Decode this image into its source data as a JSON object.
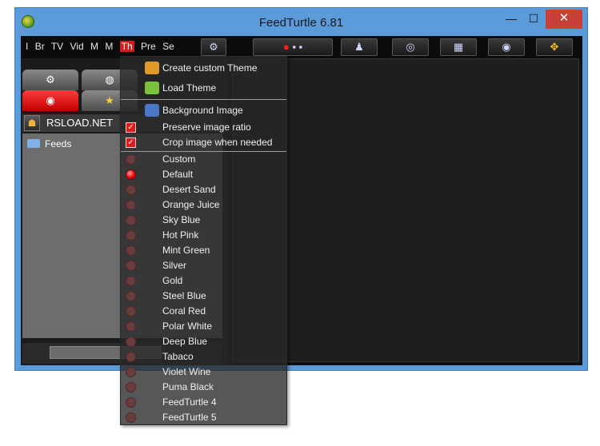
{
  "window": {
    "title": "FeedTurtle 6.81",
    "min_glyph": "—",
    "max_glyph": "☐",
    "close_glyph": "✕"
  },
  "menubar": [
    "I",
    "Br",
    "TV",
    "Vid",
    "M",
    "M",
    "Th",
    "Pre",
    "Se"
  ],
  "toolbar_icons": [
    "settings-icon",
    "record-icon",
    "speaker-icon",
    "clapper-icon",
    "globe-icon",
    "fullscreen-icon"
  ],
  "left": {
    "feed_source": "RSLOAD.NET",
    "tree_items": [
      "Feeds"
    ]
  },
  "theme_menu": {
    "create": "Create custom Theme",
    "load": "Load Theme",
    "background": "Background Image",
    "preserve": "Preserve image ratio",
    "crop": "Crop image when needed",
    "themes": [
      "Custom",
      "Default",
      "Desert Sand",
      "Orange Juice",
      "Sky Blue",
      "Hot Pink",
      "Mint Green",
      "Silver",
      "Gold",
      "Steel Blue",
      "Coral Red",
      "Polar White",
      "Deep Blue",
      "Tabaco",
      "Violet Wine",
      "Puma Black",
      "FeedTurtle 4",
      "FeedTurtle 5"
    ],
    "selected": "Default"
  },
  "colors": {
    "accent": "#d21d1d",
    "titlebar": "#5b9bd9",
    "close": "#c7403a"
  }
}
